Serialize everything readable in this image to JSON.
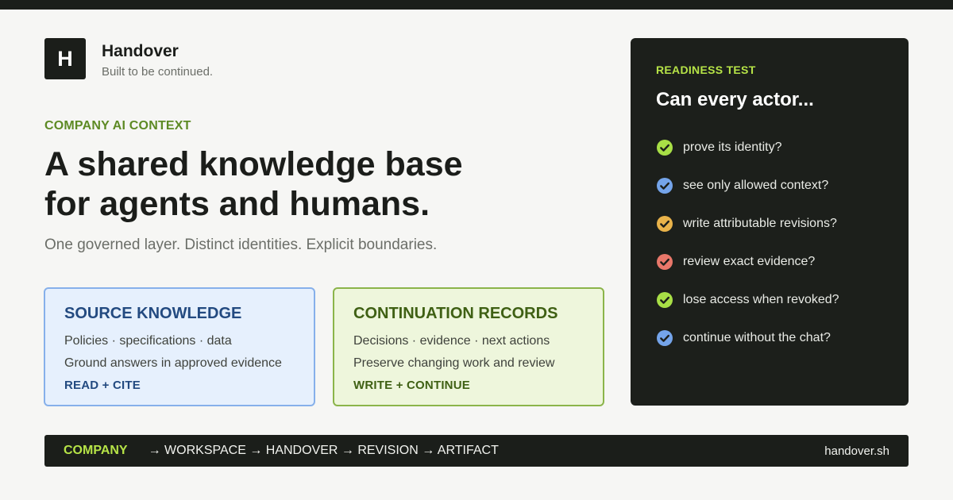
{
  "brand": {
    "logo_letter": "H",
    "name": "Handover",
    "tagline": "Built to be continued."
  },
  "hero": {
    "eyebrow": "COMPANY AI CONTEXT",
    "headline_line1": "A shared knowledge base",
    "headline_line2": "for agents and humans.",
    "subhead": "One governed layer. Distinct identities. Explicit boundaries."
  },
  "cards": {
    "source": {
      "title": "SOURCE KNOWLEDGE",
      "line1": "Policies · specifications · data",
      "line2": "Ground answers in approved evidence",
      "action": "READ + CITE"
    },
    "continuation": {
      "title": "CONTINUATION RECORDS",
      "line1": "Decisions · evidence · next actions",
      "line2": "Preserve changing work and review",
      "action": "WRITE + CONTINUE"
    }
  },
  "readiness": {
    "eyebrow": "READINESS TEST",
    "title": "Can every actor...",
    "items": [
      {
        "text": "prove its identity?",
        "icon": "check-circle-icon",
        "color": "#a8df46"
      },
      {
        "text": "see only allowed context?",
        "icon": "check-circle-icon",
        "color": "#74a4ea"
      },
      {
        "text": "write attributable revisions?",
        "icon": "check-circle-icon",
        "color": "#e9b34a"
      },
      {
        "text": "review exact evidence?",
        "icon": "check-circle-icon",
        "color": "#e8776a"
      },
      {
        "text": "lose access when revoked?",
        "icon": "check-circle-icon",
        "color": "#a8df46"
      },
      {
        "text": "continue without the chat?",
        "icon": "check-circle-icon",
        "color": "#74a4ea"
      }
    ]
  },
  "footer": {
    "company": "COMPANY",
    "path": "→ WORKSPACE → HANDOVER → REVISION → ARTIFACT",
    "url": "handover.sh"
  },
  "colors": {
    "accent_green": "#b6e347",
    "eyebrow_green": "#5d8a24",
    "source_blue": "#234a80",
    "continuation_green": "#3f6014",
    "dark": "#1b1e1a",
    "background": "#f6f6f4"
  }
}
